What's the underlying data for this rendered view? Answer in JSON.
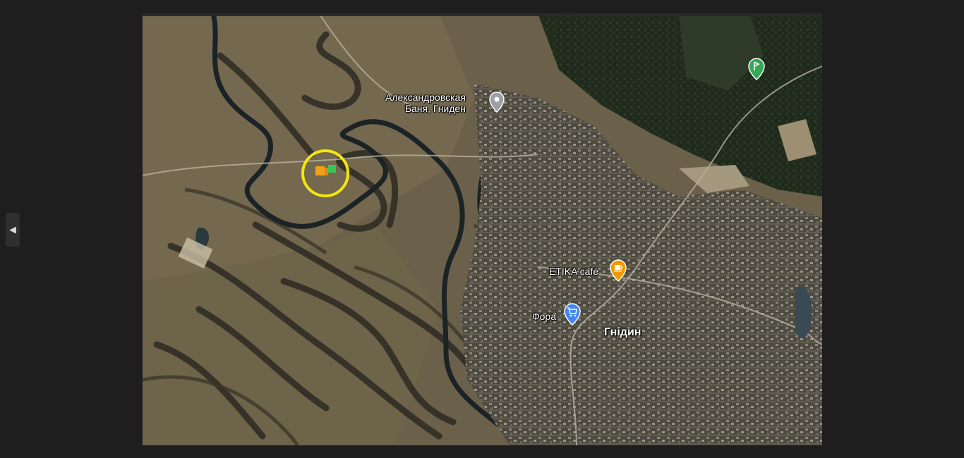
{
  "viewer": {
    "prev_icon": "chevron-left-icon",
    "prev_glyph": "◀"
  },
  "map": {
    "type": "satellite",
    "pois": [
      {
        "name": "Александровская Баня, Гниден",
        "line1": "Александровская",
        "line2": "Баня, Гниден",
        "icon": "map-pin-icon",
        "color": "#9aa0a6"
      },
      {
        "name": "ETIKA café",
        "icon": "coffee-icon",
        "color": "#f29900"
      },
      {
        "name": "Фора",
        "icon": "shopping-cart-icon",
        "color": "#4285f4"
      },
      {
        "name": "golf",
        "icon": "golf-icon",
        "color": "#34a853"
      }
    ],
    "town": "Гнідин",
    "highlight": {
      "color": "#f4e60f",
      "plot_colors": [
        "#f2a11a",
        "#38c65a"
      ]
    }
  }
}
